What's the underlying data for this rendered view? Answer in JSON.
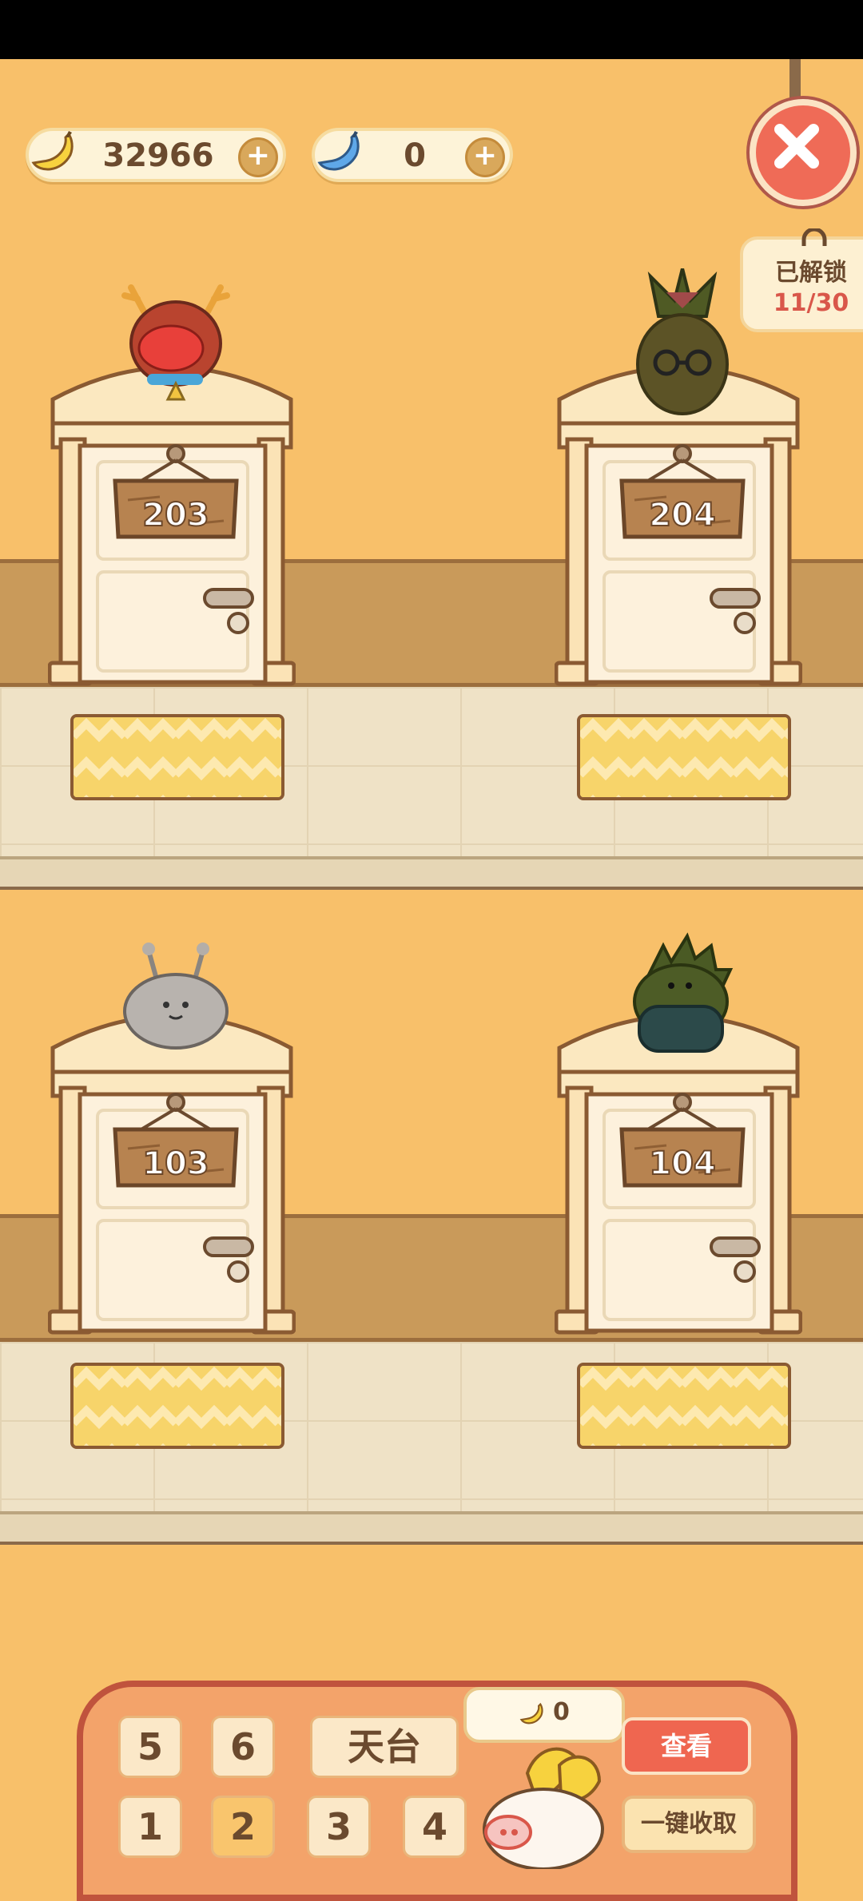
{
  "currency": {
    "bananas": {
      "value": "32966",
      "icon": "banana-icon"
    },
    "blue_bananas": {
      "value": "0",
      "icon": "blue-banana-icon"
    },
    "plus_symbol": "+"
  },
  "unlock": {
    "label": "已解锁",
    "count": "11/30"
  },
  "rooms": [
    {
      "number": "203",
      "character": "reindeer"
    },
    {
      "number": "204",
      "character": "pineapple"
    },
    {
      "number": "103",
      "character": "slug"
    },
    {
      "number": "104",
      "character": "dinosaur"
    }
  ],
  "floor_selector": {
    "top_row": [
      "5",
      "6",
      "天台"
    ],
    "bottom_row": [
      "1",
      "2",
      "3",
      "4"
    ]
  },
  "collect_bubble": {
    "value": "0"
  },
  "buttons": {
    "view": "查看",
    "collect_all": "一键收取"
  },
  "colors": {
    "background": "#f8c06a",
    "close": "#ef6b57",
    "panel": "#f3a36a",
    "accent_red": "#ef6650"
  }
}
